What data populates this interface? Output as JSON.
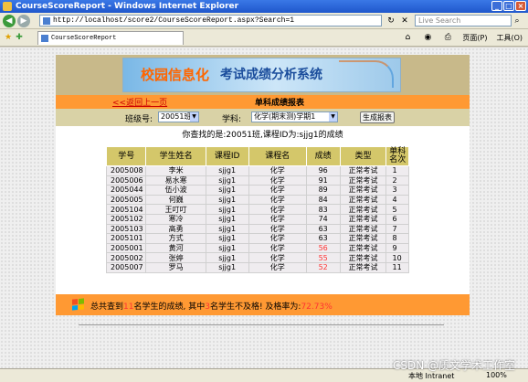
{
  "window": {
    "title": "CourseScoreReport - Windows Internet Explorer"
  },
  "addressbar": {
    "url": "http://localhost/score2/CourseScoreReport.aspx?Search=1",
    "search_placeholder": "Live Search"
  },
  "tab": {
    "label": "CourseScoreReport"
  },
  "commandbar": {
    "page_menu": "页面(P)",
    "tools_menu": "工具(O)"
  },
  "banner": {
    "title_part1": "校园信息化",
    "title_part2": "考试成绩分析系统"
  },
  "header": {
    "back_link": "<<返回上一页",
    "subtitle": "单科成绩报表"
  },
  "filters": {
    "class_label": "班级号:",
    "class_value": "20051班",
    "subject_label": "学科:",
    "subject_value": "化学(期末测)学期1",
    "generate_button": "生成报表"
  },
  "result_text": "你查找的是:20051班,课程ID为:sjjg1的成绩",
  "table": {
    "headers": [
      "学号",
      "学生姓名",
      "课程ID",
      "课程名",
      "成绩",
      "类型",
      "单科名次"
    ],
    "rows": [
      {
        "id": "2005008",
        "name": "李米",
        "cid": "sjjg1",
        "cname": "化学",
        "score": "96",
        "type": "正常考试",
        "rank": "1",
        "fail": false
      },
      {
        "id": "2005006",
        "name": "易水寒",
        "cid": "sjjg1",
        "cname": "化学",
        "score": "91",
        "type": "正常考试",
        "rank": "2",
        "fail": false
      },
      {
        "id": "2005044",
        "name": "伍小波",
        "cid": "sjjg1",
        "cname": "化学",
        "score": "89",
        "type": "正常考试",
        "rank": "3",
        "fail": false
      },
      {
        "id": "2005005",
        "name": "何巍",
        "cid": "sjjg1",
        "cname": "化学",
        "score": "84",
        "type": "正常考试",
        "rank": "4",
        "fail": false
      },
      {
        "id": "2005104",
        "name": "王叮叮",
        "cid": "sjjg1",
        "cname": "化学",
        "score": "83",
        "type": "正常考试",
        "rank": "5",
        "fail": false
      },
      {
        "id": "2005102",
        "name": "寒冷",
        "cid": "sjjg1",
        "cname": "化学",
        "score": "74",
        "type": "正常考试",
        "rank": "6",
        "fail": false
      },
      {
        "id": "2005103",
        "name": "高勇",
        "cid": "sjjg1",
        "cname": "化学",
        "score": "63",
        "type": "正常考试",
        "rank": "7",
        "fail": false
      },
      {
        "id": "2005101",
        "name": "方式",
        "cid": "sjjg1",
        "cname": "化学",
        "score": "63",
        "type": "正常考试",
        "rank": "8",
        "fail": false
      },
      {
        "id": "2005001",
        "name": "黄河",
        "cid": "sjjg1",
        "cname": "化学",
        "score": "56",
        "type": "正常考试",
        "rank": "9",
        "fail": true
      },
      {
        "id": "2005002",
        "name": "张婷",
        "cid": "sjjg1",
        "cname": "化学",
        "score": "55",
        "type": "正常考试",
        "rank": "10",
        "fail": true
      },
      {
        "id": "2005007",
        "name": "罗马",
        "cid": "sjjg1",
        "cname": "化学",
        "score": "52",
        "type": "正常考试",
        "rank": "11",
        "fail": true
      }
    ]
  },
  "summary": {
    "part1": "总共查到",
    "count": "11",
    "part2": "名学生的成绩,  其中",
    "fail_count": "3",
    "part3": "名学生不及格!  及格率为:",
    "pass_rate": "72.73%"
  },
  "statusbar": {
    "zone": "本地 Intranet",
    "zoom": "100%"
  },
  "watermark": "CSDN @质文学术工作室",
  "colors": {
    "orange": "#ff9933",
    "olive": "#d9d2a6",
    "header_gold": "#d4c76a",
    "fail_red": "#ff3333"
  }
}
